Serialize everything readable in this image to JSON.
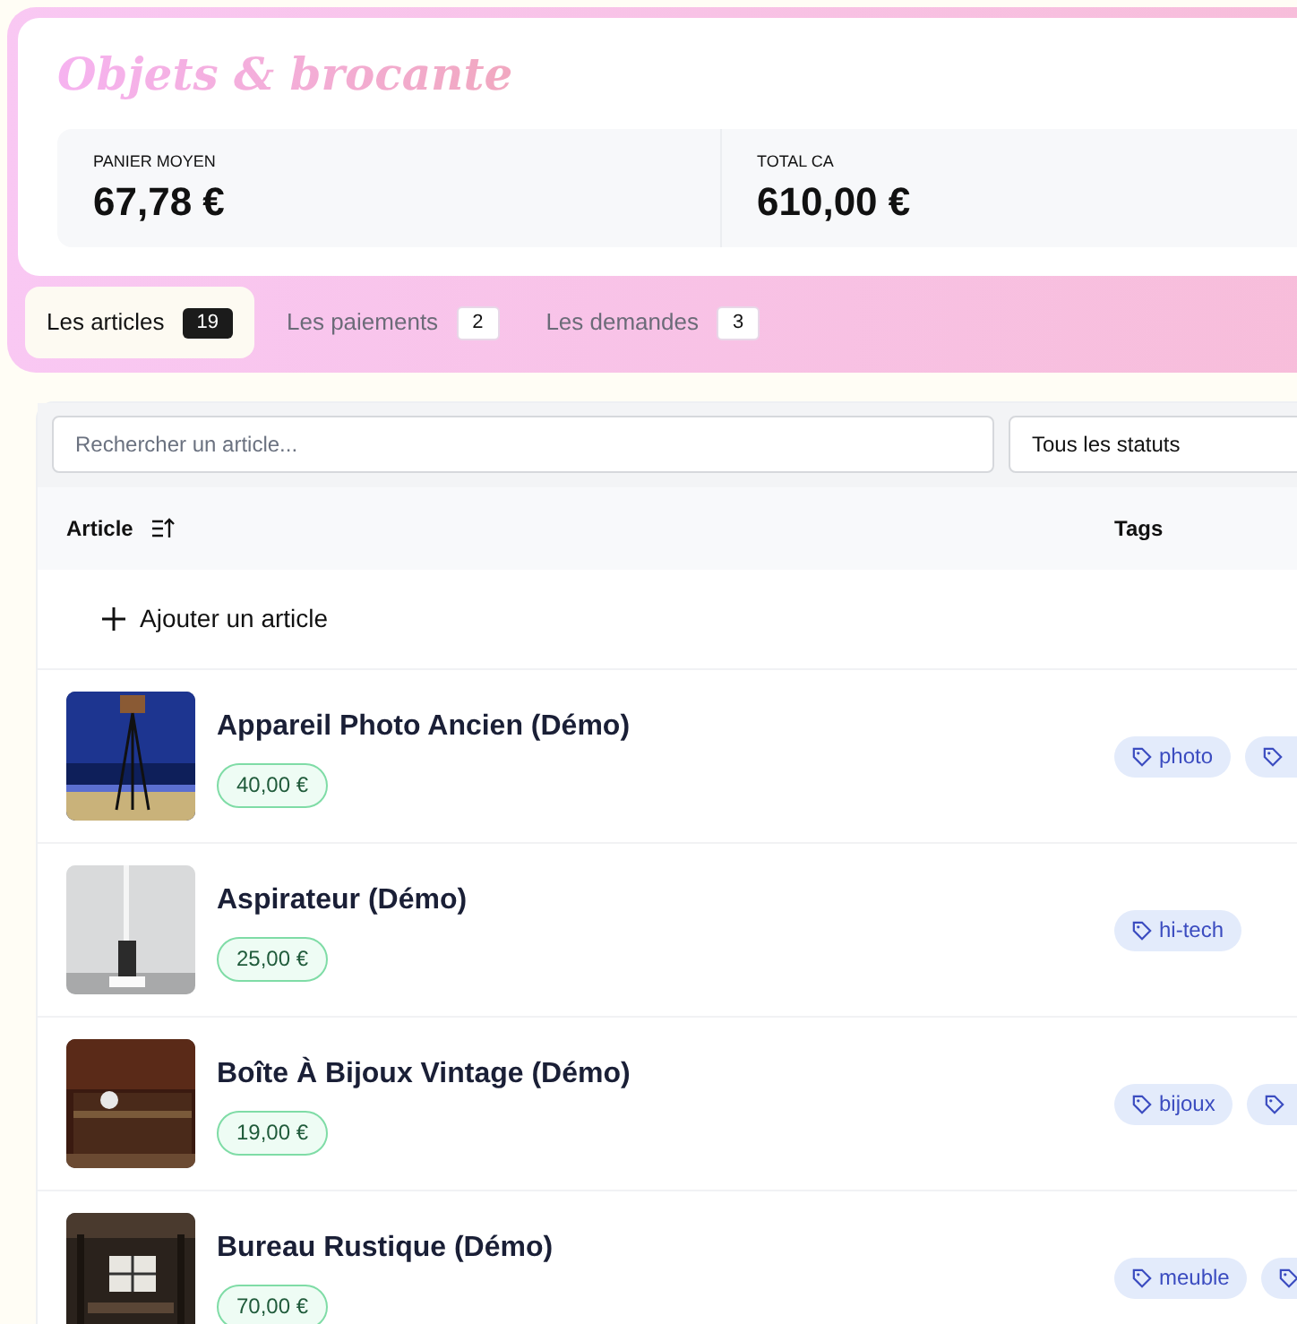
{
  "title": "Objets & brocante",
  "stats": [
    {
      "label": "PANIER MOYEN",
      "value": "67,78 €"
    },
    {
      "label": "TOTAL CA",
      "value": "610,00 €"
    }
  ],
  "tabs": [
    {
      "label": "Les articles",
      "count": "19",
      "selected": true
    },
    {
      "label": "Les paiements",
      "count": "2",
      "selected": false
    },
    {
      "label": "Les demandes",
      "count": "3",
      "selected": false
    }
  ],
  "search": {
    "placeholder": "Rechercher un article..."
  },
  "status_filter": {
    "value": "Tous les statuts"
  },
  "table": {
    "columns": [
      "Article",
      "Tags"
    ],
    "add_button": "Ajouter un article",
    "rows": [
      {
        "name": "Appareil Photo Ancien (Démo)",
        "price": "40,00 €",
        "tags": [
          "photo"
        ],
        "more_tags": true,
        "picture": {
          "kind": "picture"
        }
      },
      {
        "name": "Aspirateur (Démo)",
        "price": "25,00 €",
        "tags": [
          "hi-tech"
        ],
        "more_tags": false,
        "picture": {
          "kind": "picture"
        }
      },
      {
        "name": "Boîte À Bijoux Vintage (Démo)",
        "price": "19,00 €",
        "tags": [
          "bijoux"
        ],
        "more_tags": true,
        "picture": {
          "kind": "picture"
        }
      },
      {
        "name": "Bureau Rustique (Démo)",
        "price": "70,00 €",
        "tags": [
          "meuble"
        ],
        "more_tags": true,
        "picture": {
          "kind": "picture"
        }
      }
    ]
  }
}
